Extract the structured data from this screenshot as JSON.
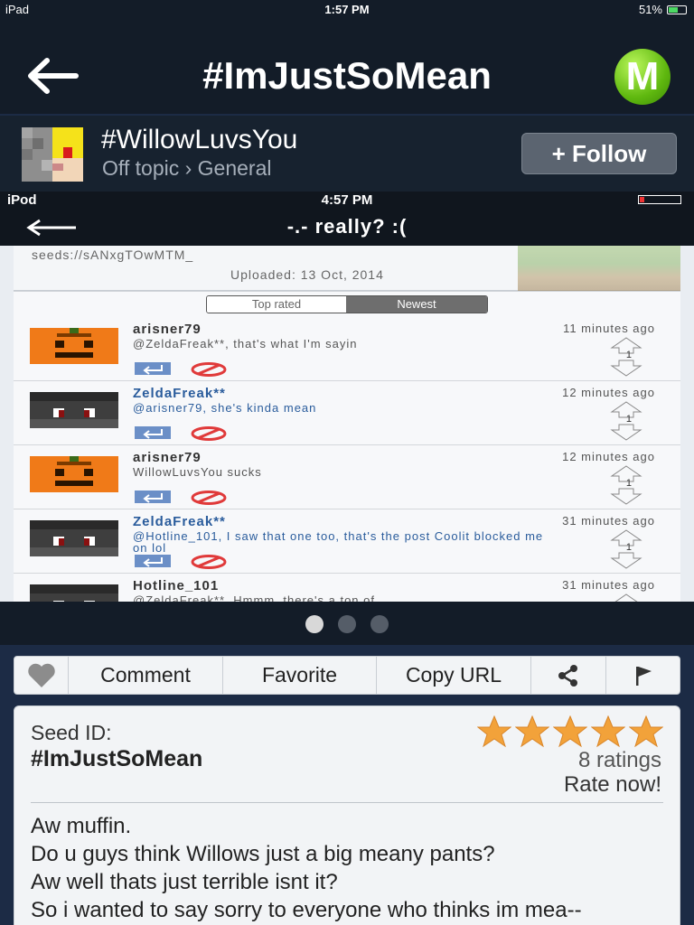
{
  "status_bar": {
    "device": "iPad",
    "time": "1:57 PM",
    "battery": "51%",
    "battery_level": 0.51
  },
  "nav": {
    "title": "#ImJustSoMean",
    "back_icon": "back-arrow-icon",
    "logo_letter": "M",
    "logo_color": "#6cc31a"
  },
  "author": {
    "name": "#WillowLuvsYou",
    "category": "Off topic › General",
    "follow_label": "+ Follow"
  },
  "screenshot": {
    "status": {
      "device": "iPod",
      "time": "4:57 PM"
    },
    "title": "-.- really? :(",
    "seeds_text": "seeds://sANxgTOwMTM_",
    "uploaded": "Uploaded: 13 Oct, 2014",
    "tabs": [
      "Top rated",
      "Newest"
    ],
    "comments": [
      {
        "user": "arisner79",
        "time": "11 minutes ago",
        "text": "@ZeldaFreak**, that's what I'm sayin",
        "votes": "1",
        "avatar": "pumpkin"
      },
      {
        "user": "ZeldaFreak**",
        "time": "12 minutes ago",
        "text": "@arisner79, she's kinda mean",
        "votes": "1",
        "avatar": "dark"
      },
      {
        "user": "arisner79",
        "time": "12 minutes ago",
        "text": "WillowLuvsYou sucks",
        "votes": "1",
        "avatar": "pumpkin"
      },
      {
        "user": "ZeldaFreak**",
        "time": "31 minutes ago",
        "text": "@Hotline_101, I saw that one too, that's the post Coolit blocked me on lol",
        "votes": "1",
        "avatar": "dark"
      },
      {
        "user": "Hotline_101",
        "time": "31 minutes ago",
        "text": "@ZeldaFreak**, Hmmm, there's a ton of",
        "votes": "",
        "avatar": "dark"
      }
    ]
  },
  "pager": {
    "count": 3,
    "active": 0
  },
  "actions": {
    "like_icon": "heart-icon",
    "comment": "Comment",
    "favorite": "Favorite",
    "copy_url": "Copy URL",
    "share_icon": "share-icon",
    "flag_icon": "flag-icon"
  },
  "detail": {
    "seed_label": "Seed ID:",
    "seed_id": "#ImJustSoMean",
    "stars": 5,
    "ratings": "8 ratings",
    "rate_now": "Rate now!",
    "description": [
      "Aw muffin.",
      "Do u guys think Willows just a big meany pants?",
      "Aw well thats just terrible isnt it?",
      "So i wanted to say sorry to everyone who thinks im mea--"
    ]
  }
}
